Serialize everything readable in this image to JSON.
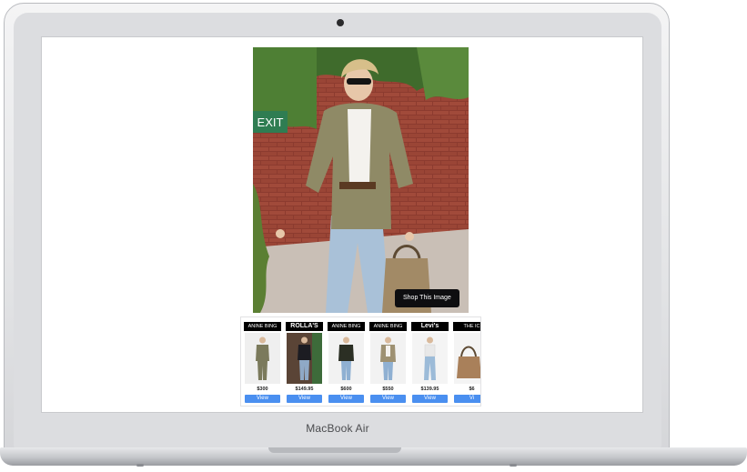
{
  "device": {
    "label": "MacBook Air"
  },
  "hero": {
    "alt": "Woman in olive blazer, white tee, light jeans and tan handbag",
    "sign": "EXIT"
  },
  "shop_button": {
    "label": "Shop This Image"
  },
  "products": [
    {
      "brand": "ANINE BING",
      "price": "$300",
      "view": "View",
      "colors": {
        "bg": "#efefef",
        "top": "#7b7a5c",
        "bottom": "#7b7a5c"
      }
    },
    {
      "brand": "ROLLA'S",
      "price": "$149.95",
      "view": "View",
      "colors": {
        "bg": "#5a4436",
        "top": "#1c1c22",
        "bottom": "#8fa9c6"
      }
    },
    {
      "brand": "ANINE BING",
      "price": "$600",
      "view": "View",
      "colors": {
        "bg": "#f2f2f2",
        "top": "#2b2f24",
        "bottom": "#8fb0d2"
      }
    },
    {
      "brand": "ANINE BING",
      "price": "$550",
      "view": "View",
      "colors": {
        "bg": "#f2f2f2",
        "top": "#9e9172",
        "bottom": "#8fb0d2"
      }
    },
    {
      "brand": "Levi's",
      "price": "$139.95",
      "view": "View",
      "colors": {
        "bg": "#f4f4f4",
        "top": "#efefef",
        "bottom": "#9cbbd8"
      }
    },
    {
      "brand": "THE IC",
      "price": "$6",
      "view": "Vi",
      "colors": {
        "bg": "#f4f4f4",
        "top": "#a9805a",
        "bottom": "#a9805a"
      }
    }
  ]
}
